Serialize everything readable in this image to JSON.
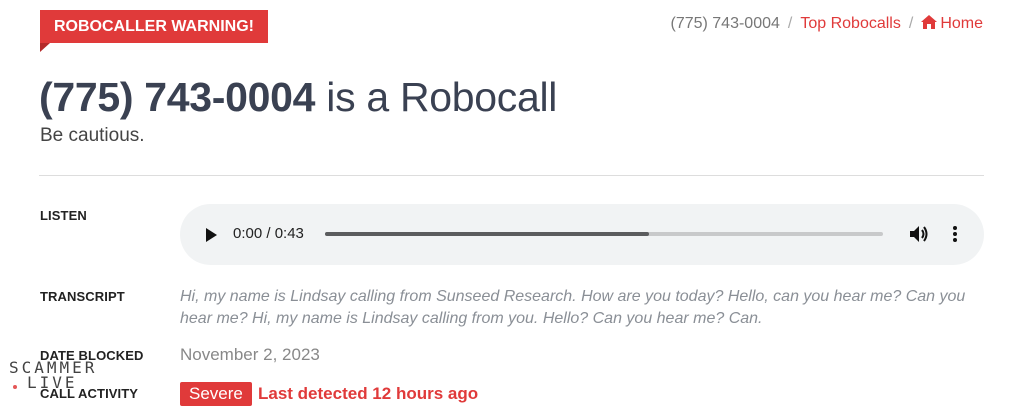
{
  "badge": "ROBOCALLER WARNING!",
  "breadcrumb": {
    "current": "(775) 743-0004",
    "link": "Top Robocalls",
    "home": "Home"
  },
  "title": {
    "number": "(775) 743-0004",
    "suffix": "is a Robocall"
  },
  "subtitle": "Be cautious.",
  "listen": {
    "label": "LISTEN",
    "time": "0:00 / 0:43",
    "progress": 0.58
  },
  "transcript": {
    "label": "TRANSCRIPT",
    "text": "Hi, my name is Lindsay calling from Sunseed Research. How are you today? Hello, can you hear me? Can you hear me? Hi, my name is Lindsay calling from you. Hello? Can you hear me? Can."
  },
  "date_blocked": {
    "label": "DATE BLOCKED",
    "value": "November 2, 2023"
  },
  "call_activity": {
    "label": "CALL ACTIVITY",
    "severity": "Severe",
    "last": "Last detected 12 hours ago"
  },
  "watermark": {
    "line1": "SCAMMER",
    "line2": "LIVE"
  },
  "colors": {
    "accent": "#e03a3a",
    "player_bg": "#f1f3f4"
  }
}
